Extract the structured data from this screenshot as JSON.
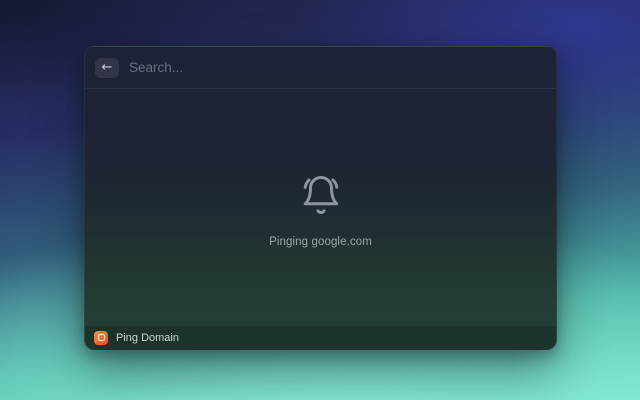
{
  "window": {
    "header": {
      "back_icon": "arrow-left-icon",
      "back_glyph": "←",
      "search": {
        "placeholder": "Search...",
        "value": ""
      }
    },
    "body": {
      "status_icon": "bell-ring-icon",
      "status_message": "Pinging google.com"
    },
    "footer": {
      "extension_icon": "ping-domain-extension-icon",
      "action_label": "Ping Domain"
    }
  },
  "colors": {
    "accent_orange": "#ef6a32",
    "window_top": "#1e2236",
    "window_bottom": "#264237",
    "background_top": "#1e2244",
    "background_indigo": "#3842b9",
    "background_bottom": "#8df0da",
    "icon_gray": "#8e979f",
    "muted_text": "#9ca5a8",
    "placeholder_text": "#6b7283"
  }
}
